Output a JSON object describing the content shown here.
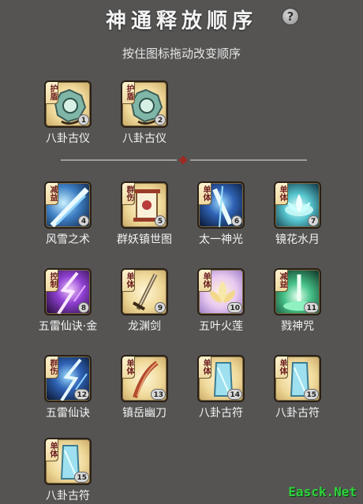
{
  "header": {
    "title": "神通释放顺序",
    "help_glyph": "?",
    "subtitle": "按住图标拖动改变顺序"
  },
  "equipped": [
    {
      "label": "八卦古仪",
      "tag": "护盾",
      "order": "1",
      "icon": "bagua-mirror-icon",
      "bg": "bg-gold"
    },
    {
      "label": "八卦古仪",
      "tag": "护盾",
      "order": "2",
      "icon": "bagua-mirror-icon",
      "bg": "bg-gold"
    }
  ],
  "skills": [
    {
      "label": "风雪之术",
      "tag": "减益",
      "order": "4",
      "icon": "blizzard-icon",
      "bg": "bg-blue"
    },
    {
      "label": "群妖镇世图",
      "tag": "群伤",
      "order": "5",
      "icon": "scroll-icon",
      "bg": "bg-gold"
    },
    {
      "label": "太一神光",
      "tag": "单体",
      "order": "6",
      "icon": "divine-light-icon",
      "bg": "bg-navy"
    },
    {
      "label": "镜花水月",
      "tag": "单体",
      "order": "7",
      "icon": "lotus-flower-icon",
      "bg": "bg-teal"
    },
    {
      "label": "五雷仙诀·金",
      "tag": "控制",
      "order": "8",
      "icon": "purple-lightning-icon",
      "bg": "bg-purple"
    },
    {
      "label": "龙渊剑",
      "tag": "单体",
      "order": "9",
      "icon": "sword-icon",
      "bg": "bg-gold"
    },
    {
      "label": "五叶火莲",
      "tag": "单体",
      "order": "10",
      "icon": "fire-lotus-icon",
      "bg": "bg-purple"
    },
    {
      "label": "戮神咒",
      "tag": "减益",
      "order": "11",
      "icon": "green-curse-icon",
      "bg": "bg-green"
    },
    {
      "label": "五雷仙诀",
      "tag": "群伤",
      "order": "12",
      "icon": "blue-lightning-icon",
      "bg": "bg-navy"
    },
    {
      "label": "镇岳幽刀",
      "tag": "单体",
      "order": "13",
      "icon": "saber-icon",
      "bg": "bg-gold"
    },
    {
      "label": "八卦古符",
      "tag": "单体",
      "order": "14",
      "icon": "talisman-icon",
      "bg": "bg-gold"
    },
    {
      "label": "八卦古符",
      "tag": "单体",
      "order": "15",
      "icon": "talisman-icon",
      "bg": "bg-gold"
    },
    {
      "label": "八卦古符",
      "tag": "单体",
      "order": "15",
      "icon": "talisman-icon",
      "bg": "bg-gold"
    }
  ],
  "watermark": "Easck.Net"
}
